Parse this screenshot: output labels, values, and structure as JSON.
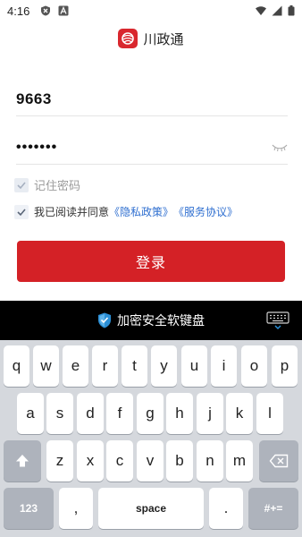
{
  "status_bar": {
    "time": "4:16",
    "icons_left": [
      "shield-x-icon",
      "a-letter-icon"
    ],
    "icons_right": [
      "wifi-icon",
      "signal-icon",
      "battery-icon"
    ]
  },
  "brand": {
    "name": "川政通",
    "logo_color": "#d9272e"
  },
  "login_form": {
    "account_value": "9663",
    "password_value": "•••••••",
    "password_toggle_icon": "eye-closed-icon",
    "remember_label": "记住密码",
    "agree_prefix": "我已阅读并同意",
    "privacy_link": "《隐私政策》",
    "service_link": "《服务协议》",
    "login_button": "登录",
    "primary_color": "#d42126",
    "link_color": "#2f6fd0"
  },
  "keyboard": {
    "title": "加密安全软键盘",
    "shield_icon": "shield-check-icon",
    "toggle_icon": "keyboard-hide-icon",
    "row1": [
      "q",
      "w",
      "e",
      "r",
      "t",
      "y",
      "u",
      "i",
      "o",
      "p"
    ],
    "row2": [
      "a",
      "s",
      "d",
      "f",
      "g",
      "h",
      "j",
      "k",
      "l"
    ],
    "row3": [
      "z",
      "x",
      "c",
      "v",
      "b",
      "n",
      "m"
    ],
    "shift_icon": "shift-arrow-icon",
    "backspace_icon": "backspace-icon",
    "key_123": "123",
    "key_comma": ",",
    "key_space": "space",
    "key_period": ".",
    "key_symbols": "#+="
  }
}
